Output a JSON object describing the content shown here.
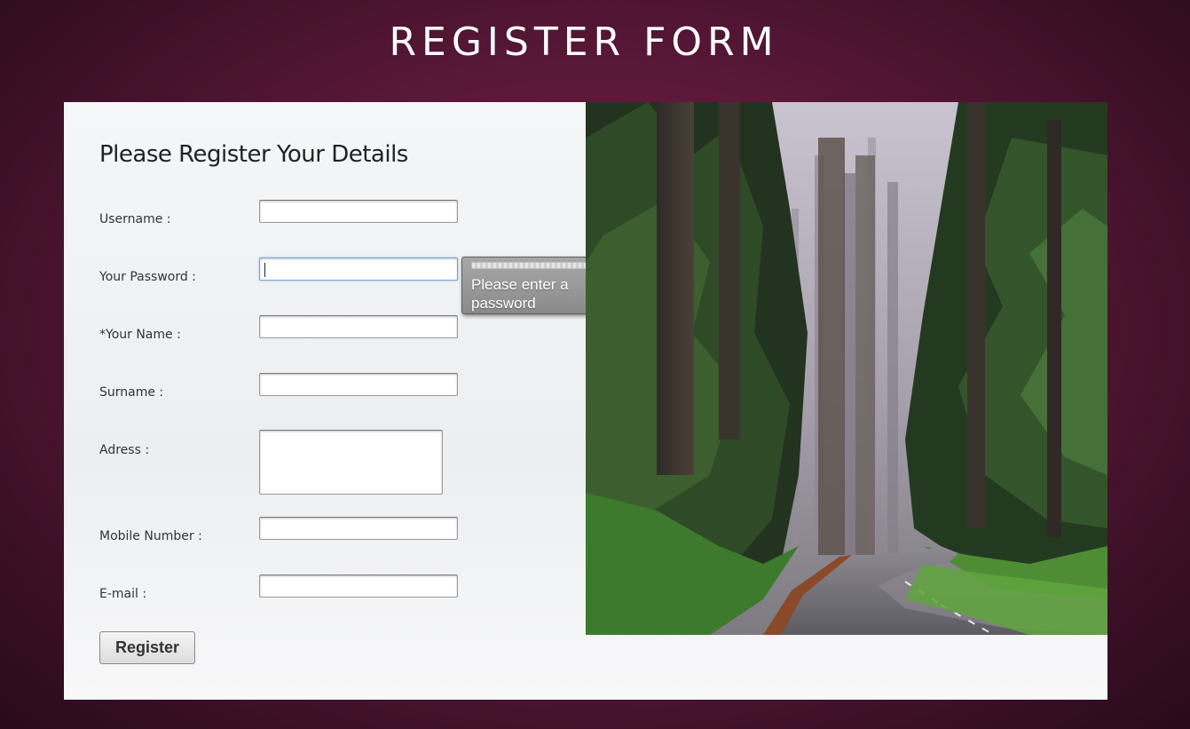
{
  "page": {
    "title": "REGISTER FORM"
  },
  "form": {
    "heading": "Please Register Your Details",
    "fields": [
      {
        "label": "Username :",
        "value": ""
      },
      {
        "label": "Your Password :",
        "value": ""
      },
      {
        "label": "*Your Name :",
        "value": ""
      },
      {
        "label": "Surname :",
        "value": ""
      },
      {
        "label": "Adress :",
        "value": ""
      },
      {
        "label": "Mobile Number :",
        "value": ""
      },
      {
        "label": "E-mail :",
        "value": ""
      }
    ],
    "submit_label": "Register"
  },
  "validation": {
    "message": "Please enter a password",
    "icon": "validation-bubble-icon"
  },
  "image": {
    "subject": "forest-road-photo"
  },
  "colors": {
    "background": "#5a1838",
    "panel": "#f0f1f3",
    "tooltip": "#999999"
  }
}
